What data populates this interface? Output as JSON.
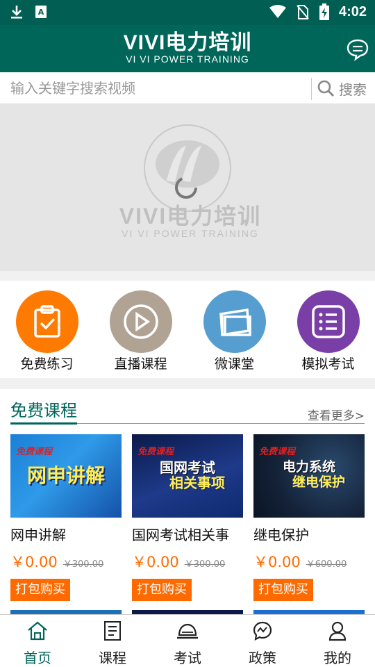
{
  "status_bar": {
    "time": "4:02"
  },
  "header": {
    "title": "VIVI电力培训",
    "subtitle": "VI VI POWER TRAINING"
  },
  "search": {
    "placeholder": "输入关键字搜索视频",
    "button_label": "搜索"
  },
  "banner": {
    "brand_title": "VIVI电力培训",
    "brand_subtitle": "VI VI POWER TRAINING",
    "seal_text": "VI VI 电力培训"
  },
  "quick_links": [
    {
      "label": "免费练习",
      "icon": "clipboard-check-icon",
      "color": "#ff7a00"
    },
    {
      "label": "直播课程",
      "icon": "play-circle-icon",
      "color": "#b1a394"
    },
    {
      "label": "微课堂",
      "icon": "photo-cards-icon",
      "color": "#579ed0"
    },
    {
      "label": "模拟考试",
      "icon": "list-icon",
      "color": "#7a3fa6"
    }
  ],
  "free_courses": {
    "title": "免费课程",
    "more_label": "查看更多>",
    "items": [
      {
        "name": "网申讲解",
        "price": "￥0.00",
        "original_price": "￥300.00",
        "buy_label": "打包购买",
        "thumb_tag": "免费课程",
        "thumb_title": "网申讲解"
      },
      {
        "name": "国网考试相关事",
        "price": "￥0.00",
        "original_price": "￥300.00",
        "buy_label": "打包购买",
        "thumb_tag": "免费课程",
        "thumb_title_1": "国网考试",
        "thumb_title_2": "相关事项"
      },
      {
        "name": "继电保护",
        "price": "￥0.00",
        "original_price": "￥600.00",
        "buy_label": "打包购买",
        "thumb_tag": "免费课程",
        "thumb_title_1": "电力系统",
        "thumb_title_2": "继电保护"
      }
    ]
  },
  "tab_bar": [
    {
      "label": "首页",
      "icon": "home-icon",
      "active": true
    },
    {
      "label": "课程",
      "icon": "document-icon",
      "active": false
    },
    {
      "label": "考试",
      "icon": "exam-bell-icon",
      "active": false
    },
    {
      "label": "政策",
      "icon": "policy-chat-icon",
      "active": false
    },
    {
      "label": "我的",
      "icon": "person-icon",
      "active": false
    }
  ],
  "colors": {
    "primary": "#00665a",
    "accent": "#ff6a00"
  }
}
